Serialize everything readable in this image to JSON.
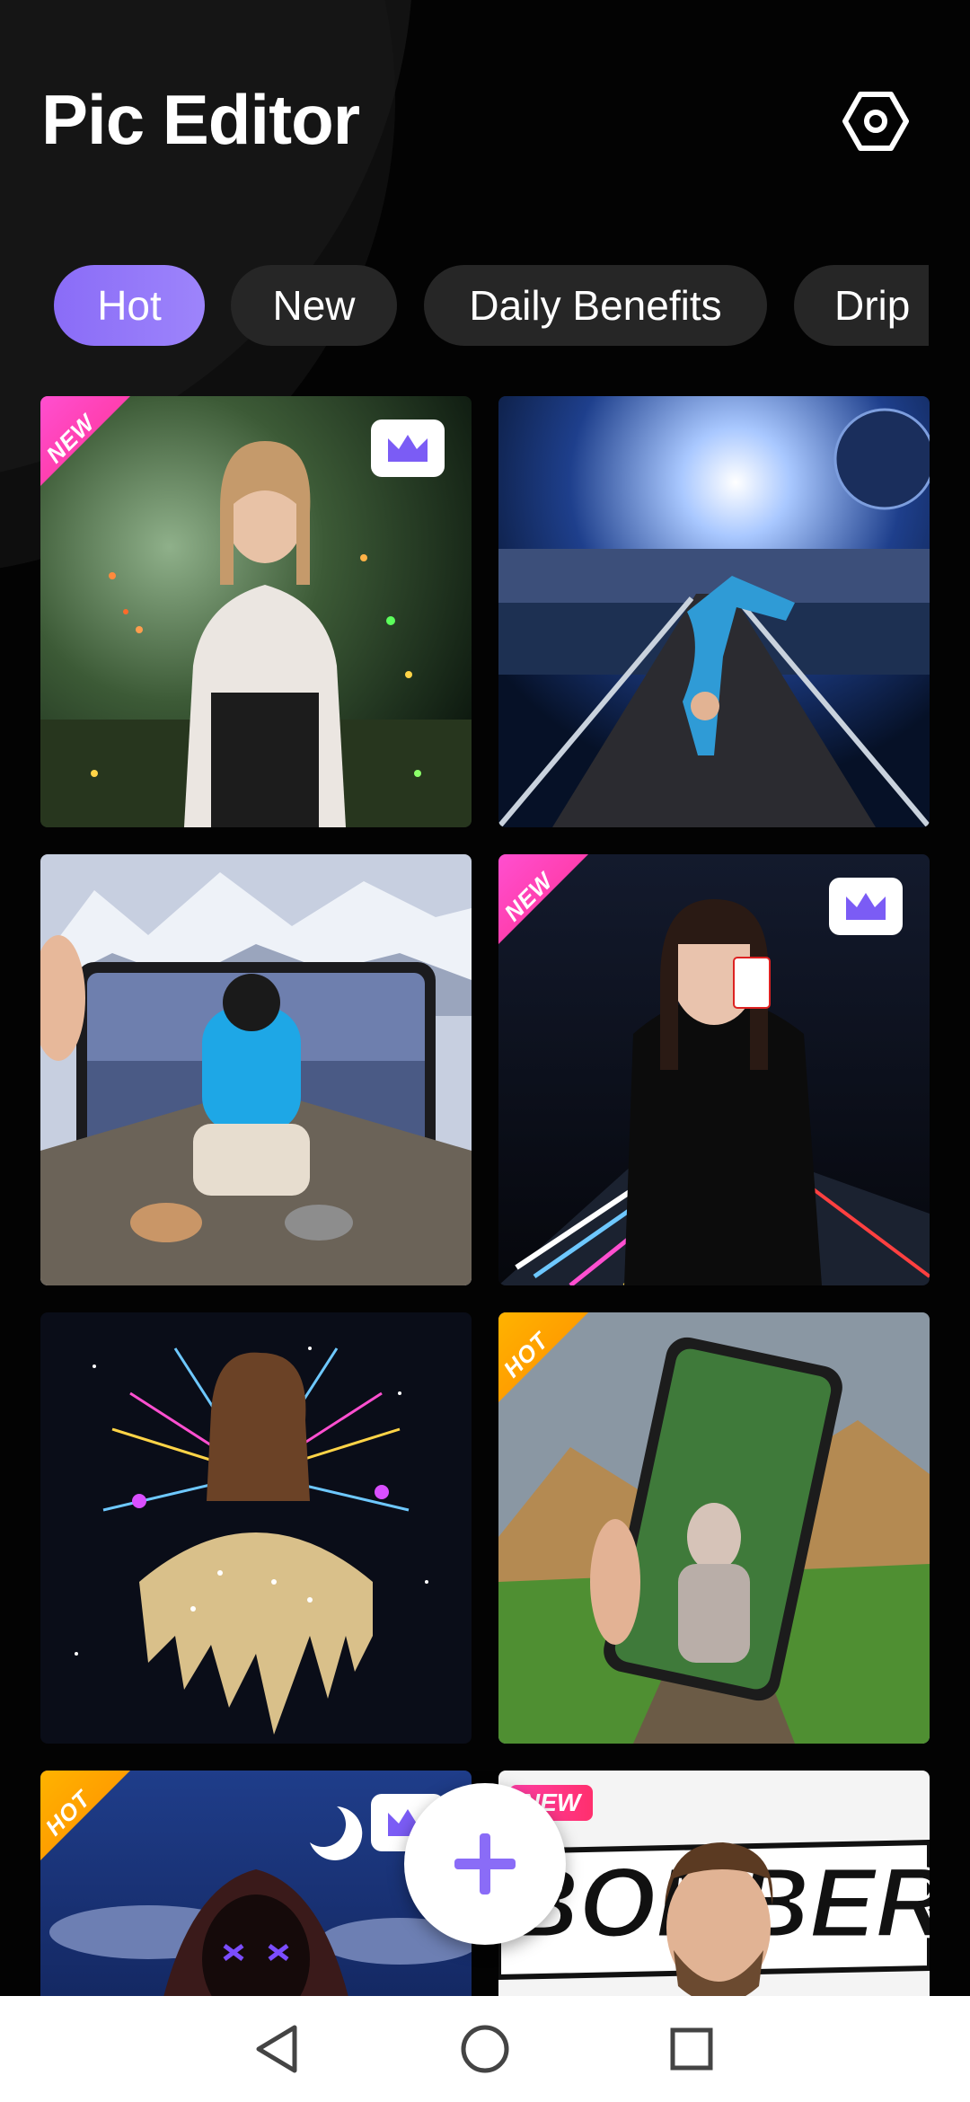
{
  "app": {
    "title": "Pic Editor"
  },
  "header": {
    "settings_icon": "settings-hexagon-icon"
  },
  "tabs": [
    {
      "label": "Hot",
      "active": true
    },
    {
      "label": "New",
      "active": false
    },
    {
      "label": "Daily Benefits",
      "active": false
    },
    {
      "label": "Drip",
      "active": false
    }
  ],
  "templates": [
    {
      "id": "forest-fireflies-girl",
      "badge": "NEW",
      "premium": true
    },
    {
      "id": "bridge-breakdancer",
      "badge": "",
      "premium": false
    },
    {
      "id": "phone-frame-pier",
      "badge": "",
      "premium": false
    },
    {
      "id": "neon-card-girl",
      "badge": "NEW",
      "premium": true
    },
    {
      "id": "glitter-drip-fireworks",
      "badge": "",
      "premium": false
    },
    {
      "id": "phone-mountain-rails",
      "badge": "HOT",
      "premium": false
    },
    {
      "id": "neon-mask-hoodie",
      "badge": "HOT",
      "premium": true
    },
    {
      "id": "bomber-neon-ring",
      "badge": "NEW",
      "premium": false
    }
  ],
  "fab": {
    "icon": "plus-icon"
  },
  "navbar": {
    "back_icon": "back-triangle-icon",
    "home_icon": "home-circle-icon",
    "recents_icon": "recents-square-icon"
  },
  "colors": {
    "accent": "#8a6cf7",
    "new_badge": "#ff2f8f",
    "hot_badge": "#ff9d00",
    "crown": "#7b5cf5"
  }
}
